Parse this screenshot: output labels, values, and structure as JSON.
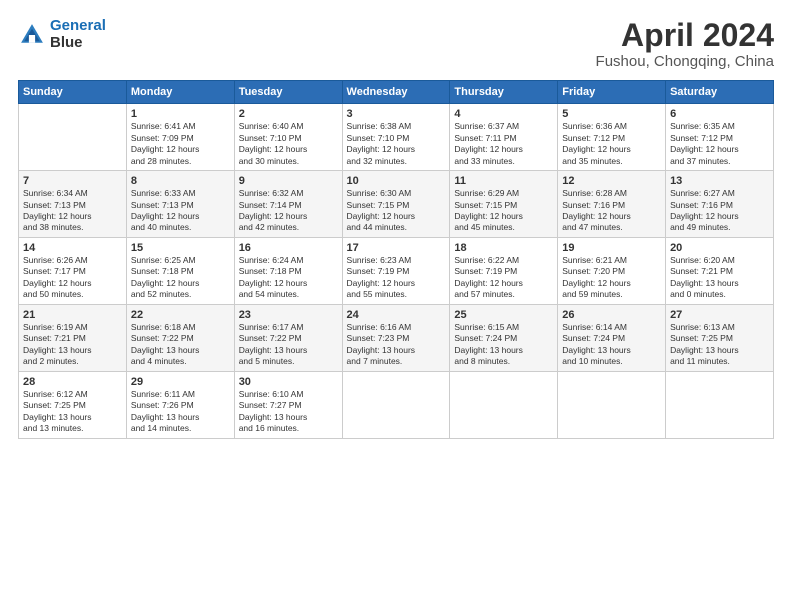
{
  "logo": {
    "line1": "General",
    "line2": "Blue"
  },
  "title": "April 2024",
  "subtitle": "Fushou, Chongqing, China",
  "days_of_week": [
    "Sunday",
    "Monday",
    "Tuesday",
    "Wednesday",
    "Thursday",
    "Friday",
    "Saturday"
  ],
  "weeks": [
    [
      {
        "num": "",
        "sunrise": "",
        "sunset": "",
        "daylight": ""
      },
      {
        "num": "1",
        "sunrise": "Sunrise: 6:41 AM",
        "sunset": "Sunset: 7:09 PM",
        "daylight": "Daylight: 12 hours and 28 minutes."
      },
      {
        "num": "2",
        "sunrise": "Sunrise: 6:40 AM",
        "sunset": "Sunset: 7:10 PM",
        "daylight": "Daylight: 12 hours and 30 minutes."
      },
      {
        "num": "3",
        "sunrise": "Sunrise: 6:38 AM",
        "sunset": "Sunset: 7:10 PM",
        "daylight": "Daylight: 12 hours and 32 minutes."
      },
      {
        "num": "4",
        "sunrise": "Sunrise: 6:37 AM",
        "sunset": "Sunset: 7:11 PM",
        "daylight": "Daylight: 12 hours and 33 minutes."
      },
      {
        "num": "5",
        "sunrise": "Sunrise: 6:36 AM",
        "sunset": "Sunset: 7:12 PM",
        "daylight": "Daylight: 12 hours and 35 minutes."
      },
      {
        "num": "6",
        "sunrise": "Sunrise: 6:35 AM",
        "sunset": "Sunset: 7:12 PM",
        "daylight": "Daylight: 12 hours and 37 minutes."
      }
    ],
    [
      {
        "num": "7",
        "sunrise": "Sunrise: 6:34 AM",
        "sunset": "Sunset: 7:13 PM",
        "daylight": "Daylight: 12 hours and 38 minutes."
      },
      {
        "num": "8",
        "sunrise": "Sunrise: 6:33 AM",
        "sunset": "Sunset: 7:13 PM",
        "daylight": "Daylight: 12 hours and 40 minutes."
      },
      {
        "num": "9",
        "sunrise": "Sunrise: 6:32 AM",
        "sunset": "Sunset: 7:14 PM",
        "daylight": "Daylight: 12 hours and 42 minutes."
      },
      {
        "num": "10",
        "sunrise": "Sunrise: 6:30 AM",
        "sunset": "Sunset: 7:15 PM",
        "daylight": "Daylight: 12 hours and 44 minutes."
      },
      {
        "num": "11",
        "sunrise": "Sunrise: 6:29 AM",
        "sunset": "Sunset: 7:15 PM",
        "daylight": "Daylight: 12 hours and 45 minutes."
      },
      {
        "num": "12",
        "sunrise": "Sunrise: 6:28 AM",
        "sunset": "Sunset: 7:16 PM",
        "daylight": "Daylight: 12 hours and 47 minutes."
      },
      {
        "num": "13",
        "sunrise": "Sunrise: 6:27 AM",
        "sunset": "Sunset: 7:16 PM",
        "daylight": "Daylight: 12 hours and 49 minutes."
      }
    ],
    [
      {
        "num": "14",
        "sunrise": "Sunrise: 6:26 AM",
        "sunset": "Sunset: 7:17 PM",
        "daylight": "Daylight: 12 hours and 50 minutes."
      },
      {
        "num": "15",
        "sunrise": "Sunrise: 6:25 AM",
        "sunset": "Sunset: 7:18 PM",
        "daylight": "Daylight: 12 hours and 52 minutes."
      },
      {
        "num": "16",
        "sunrise": "Sunrise: 6:24 AM",
        "sunset": "Sunset: 7:18 PM",
        "daylight": "Daylight: 12 hours and 54 minutes."
      },
      {
        "num": "17",
        "sunrise": "Sunrise: 6:23 AM",
        "sunset": "Sunset: 7:19 PM",
        "daylight": "Daylight: 12 hours and 55 minutes."
      },
      {
        "num": "18",
        "sunrise": "Sunrise: 6:22 AM",
        "sunset": "Sunset: 7:19 PM",
        "daylight": "Daylight: 12 hours and 57 minutes."
      },
      {
        "num": "19",
        "sunrise": "Sunrise: 6:21 AM",
        "sunset": "Sunset: 7:20 PM",
        "daylight": "Daylight: 12 hours and 59 minutes."
      },
      {
        "num": "20",
        "sunrise": "Sunrise: 6:20 AM",
        "sunset": "Sunset: 7:21 PM",
        "daylight": "Daylight: 13 hours and 0 minutes."
      }
    ],
    [
      {
        "num": "21",
        "sunrise": "Sunrise: 6:19 AM",
        "sunset": "Sunset: 7:21 PM",
        "daylight": "Daylight: 13 hours and 2 minutes."
      },
      {
        "num": "22",
        "sunrise": "Sunrise: 6:18 AM",
        "sunset": "Sunset: 7:22 PM",
        "daylight": "Daylight: 13 hours and 4 minutes."
      },
      {
        "num": "23",
        "sunrise": "Sunrise: 6:17 AM",
        "sunset": "Sunset: 7:22 PM",
        "daylight": "Daylight: 13 hours and 5 minutes."
      },
      {
        "num": "24",
        "sunrise": "Sunrise: 6:16 AM",
        "sunset": "Sunset: 7:23 PM",
        "daylight": "Daylight: 13 hours and 7 minutes."
      },
      {
        "num": "25",
        "sunrise": "Sunrise: 6:15 AM",
        "sunset": "Sunset: 7:24 PM",
        "daylight": "Daylight: 13 hours and 8 minutes."
      },
      {
        "num": "26",
        "sunrise": "Sunrise: 6:14 AM",
        "sunset": "Sunset: 7:24 PM",
        "daylight": "Daylight: 13 hours and 10 minutes."
      },
      {
        "num": "27",
        "sunrise": "Sunrise: 6:13 AM",
        "sunset": "Sunset: 7:25 PM",
        "daylight": "Daylight: 13 hours and 11 minutes."
      }
    ],
    [
      {
        "num": "28",
        "sunrise": "Sunrise: 6:12 AM",
        "sunset": "Sunset: 7:25 PM",
        "daylight": "Daylight: 13 hours and 13 minutes."
      },
      {
        "num": "29",
        "sunrise": "Sunrise: 6:11 AM",
        "sunset": "Sunset: 7:26 PM",
        "daylight": "Daylight: 13 hours and 14 minutes."
      },
      {
        "num": "30",
        "sunrise": "Sunrise: 6:10 AM",
        "sunset": "Sunset: 7:27 PM",
        "daylight": "Daylight: 13 hours and 16 minutes."
      },
      {
        "num": "",
        "sunrise": "",
        "sunset": "",
        "daylight": ""
      },
      {
        "num": "",
        "sunrise": "",
        "sunset": "",
        "daylight": ""
      },
      {
        "num": "",
        "sunrise": "",
        "sunset": "",
        "daylight": ""
      },
      {
        "num": "",
        "sunrise": "",
        "sunset": "",
        "daylight": ""
      }
    ]
  ]
}
